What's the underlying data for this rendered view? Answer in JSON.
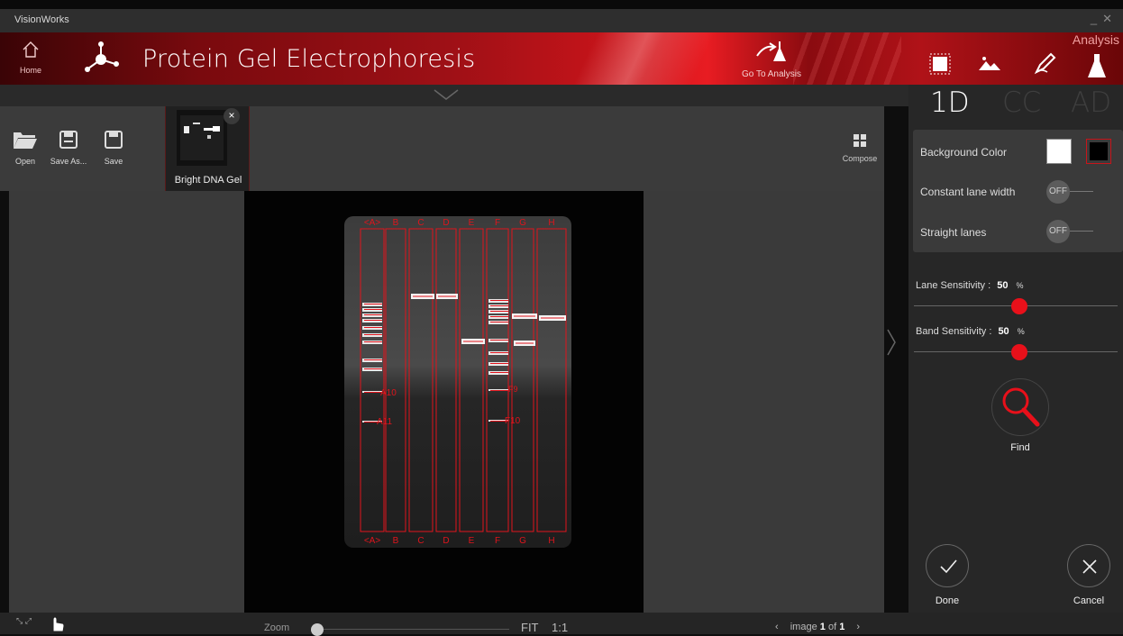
{
  "window": {
    "app_name": "VisionWorks"
  },
  "header": {
    "home_label": "Home",
    "title": "Protein Gel Electrophoresis",
    "goto_label": "Go To Analysis",
    "analysis_label": "Analysis",
    "right_icons": [
      "select-region-icon",
      "image-adjust-icon",
      "annotate-pen-icon",
      "analysis-flask-icon"
    ]
  },
  "toolbar": {
    "open_label": "Open",
    "save_as_label": "Save As...",
    "save_label": "Save",
    "thumbnail_label": "Bright DNA Gel",
    "compose_label": "Compose"
  },
  "gel": {
    "lanes_top": [
      "<A>",
      "B",
      "C",
      "D",
      "E",
      "F",
      "G",
      "H"
    ],
    "lanes_bottom": [
      "<A>",
      "B",
      "C",
      "D",
      "E",
      "F",
      "G",
      "H"
    ],
    "band_labels": [
      "A10",
      "A11",
      "F9",
      "F10"
    ],
    "accent_color": "#e0141c"
  },
  "panel": {
    "tabs": [
      "1D",
      "CC",
      "AD"
    ],
    "active_tab": "1D",
    "background_color_label": "Background Color",
    "constant_lane_label": "Constant lane width",
    "constant_lane_value": "OFF",
    "straight_lanes_label": "Straight lanes",
    "straight_lanes_value": "OFF",
    "lane_sensitivity_label": "Lane Sensitivity :",
    "lane_sensitivity_value": "50",
    "band_sensitivity_label": "Band Sensitivity :",
    "band_sensitivity_value": "50",
    "percent": "%",
    "find_label": "Find",
    "done_label": "Done",
    "cancel_label": "Cancel"
  },
  "status": {
    "zoom_label": "Zoom",
    "fit_label": "FIT",
    "one_to_one_label": "1:1",
    "page_prefix": "image",
    "page_current": "1",
    "page_of": "of",
    "page_total": "1"
  }
}
